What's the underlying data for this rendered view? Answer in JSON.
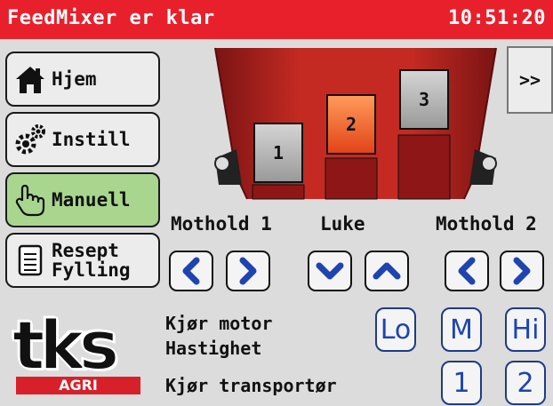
{
  "header": {
    "title": "FeedMixer er klar",
    "clock": "10:51:20"
  },
  "menu": {
    "home": "Hjem",
    "settings": "Instill",
    "manual": "Manuell",
    "recipe_line1": "Resept",
    "recipe_line2": "Fylling"
  },
  "next_label": ">>",
  "doors": {
    "d1": "1",
    "d2": "2",
    "d3": "3",
    "selected": "2"
  },
  "groups": {
    "left": "Mothold 1",
    "middle": "Luke",
    "right": "Mothold 2"
  },
  "motor": {
    "label1": "Kjør motor",
    "label2": "Hastighet",
    "lo": "Lo",
    "m": "M",
    "hi": "Hi"
  },
  "conveyor": {
    "label": "Kjør transportør",
    "b1": "1",
    "b2": "2"
  },
  "logo": {
    "main": "tks",
    "sub": "AGRI"
  },
  "colors": {
    "title_bg": "#e8202b",
    "active_menu": "#a9d68f",
    "accent_blue": "#1e44b0",
    "mixer_red": "#b52020"
  }
}
